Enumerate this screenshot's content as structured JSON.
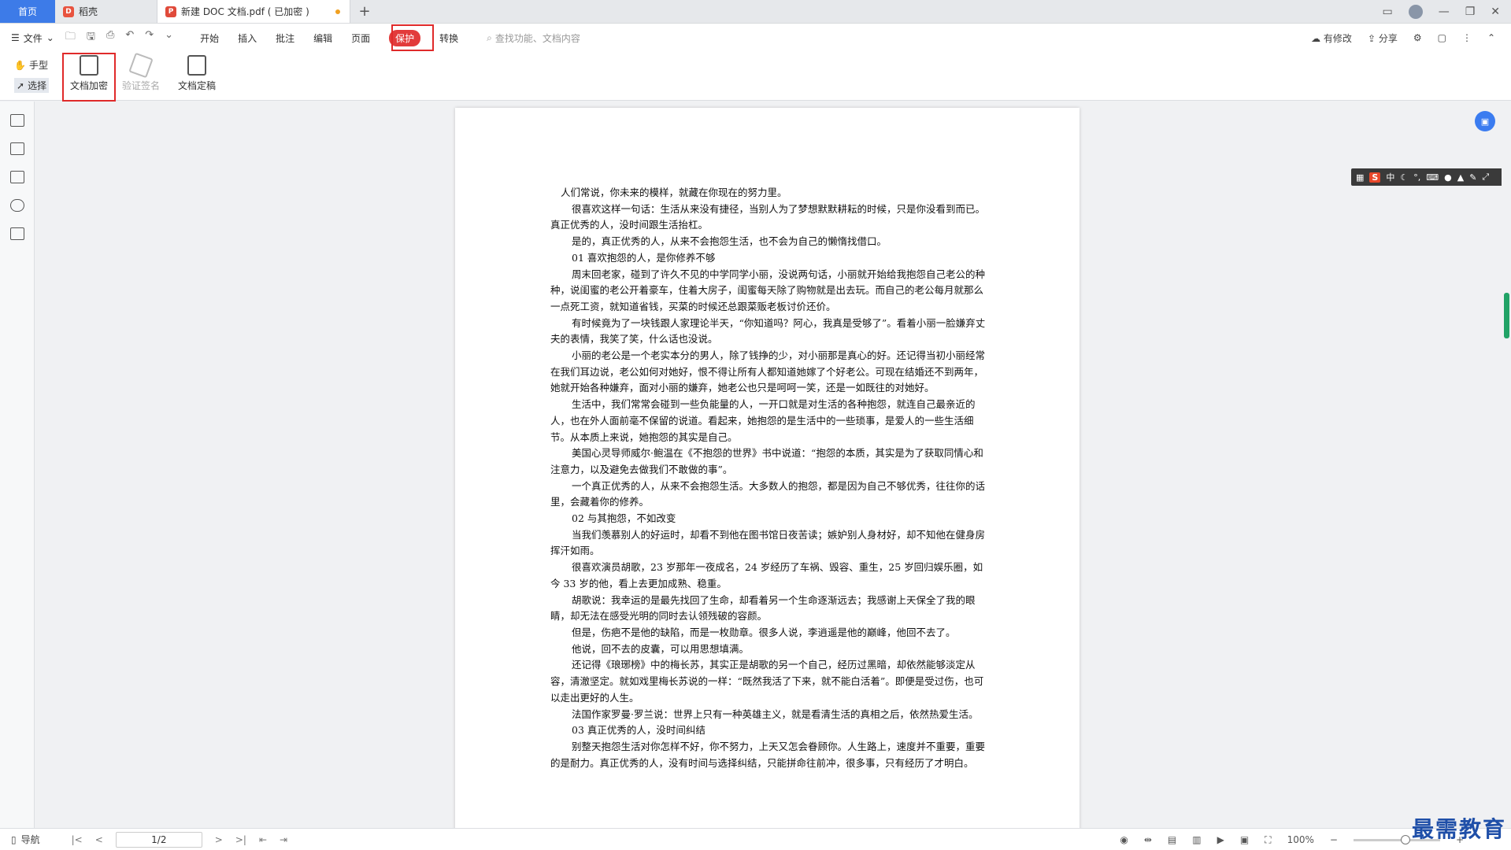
{
  "tabs": {
    "home": "首页",
    "daoke": "稻壳",
    "doc": "新建 DOC 文档.pdf ( 已加密 )",
    "add": "+"
  },
  "menu": {
    "file": "文件",
    "items": [
      "开始",
      "插入",
      "批注",
      "编辑",
      "页面",
      "保护",
      "转换"
    ],
    "search_placeholder": "查找功能、文档内容",
    "modified": "有修改",
    "share": "分享"
  },
  "ribbon": {
    "hand": "手型",
    "select": "选择",
    "encrypt": "文档加密",
    "verify_sign": "验证签名",
    "finalize": "文档定稿"
  },
  "document": {
    "paragraphs": [
      {
        "style": "first",
        "text": "人们常说，你未来的模样，就藏在你现在的努力里。"
      },
      {
        "style": "ind",
        "text": "很喜欢这样一句话：生活从来没有捷径，当别人为了梦想默默耕耘的时候，只是你没看到而已。真正优秀的人，没时间跟生活抬杠。"
      },
      {
        "style": "ind",
        "text": "是的，真正优秀的人，从来不会抱怨生活，也不会为自己的懒惰找借口。"
      },
      {
        "style": "ind",
        "text": "01 喜欢抱怨的人，是你修养不够"
      },
      {
        "style": "ind",
        "text": "周末回老家，碰到了许久不见的中学同学小丽，没说两句话，小丽就开始给我抱怨自己老公的种种，说闺蜜的老公开着豪车，住着大房子，闺蜜每天除了购物就是出去玩。而自己的老公每月就那么一点死工资，就知道省钱，买菜的时候还总跟菜贩老板讨价还价。"
      },
      {
        "style": "ind",
        "text": "有时候竟为了一块钱跟人家理论半天，“你知道吗？阿心，我真是受够了”。看着小丽一脸嫌弃丈夫的表情，我笑了笑，什么话也没说。"
      },
      {
        "style": "ind",
        "text": "小丽的老公是一个老实本分的男人，除了钱挣的少，对小丽那是真心的好。还记得当初小丽经常在我们耳边说，老公如何对她好，恨不得让所有人都知道她嫁了个好老公。可现在结婚还不到两年，她就开始各种嫌弃，面对小丽的嫌弃，她老公也只是呵呵一笑，还是一如既往的对她好。"
      },
      {
        "style": "ind",
        "text": "生活中，我们常常会碰到一些负能量的人，一开口就是对生活的各种抱怨，就连自己最亲近的人，也在外人面前毫不保留的说道。看起来，她抱怨的是生活中的一些琐事，是爱人的一些生活细节。从本质上来说，她抱怨的其实是自己。"
      },
      {
        "style": "ind",
        "text": "美国心灵导师威尔·鲍温在《不抱怨的世界》书中说道：“抱怨的本质，其实是为了获取同情心和注意力，以及避免去做我们不敢做的事”。"
      },
      {
        "style": "ind",
        "text": "一个真正优秀的人，从来不会抱怨生活。大多数人的抱怨，都是因为自己不够优秀，往往你的话里，会藏着你的修养。"
      },
      {
        "style": "ind",
        "text": "02 与其抱怨，不如改变"
      },
      {
        "style": "ind",
        "text": "当我们羡慕别人的好运时，却看不到他在图书馆日夜苦读；嫉妒别人身材好，却不知他在健身房挥汗如雨。"
      },
      {
        "style": "ind",
        "text": "很喜欢演员胡歌，23 岁那年一夜成名，24 岁经历了车祸、毁容、重生，25 岁回归娱乐圈，如今 33 岁的他，看上去更加成熟、稳重。"
      },
      {
        "style": "ind",
        "text": "胡歌说：我幸运的是最先找回了生命，却看着另一个生命逐渐远去；我感谢上天保全了我的眼睛，却无法在感受光明的同时去认领残破的容颜。"
      },
      {
        "style": "ind",
        "text": "但是，伤疤不是他的缺陷，而是一枚勋章。很多人说，李逍遥是他的巅峰，他回不去了。"
      },
      {
        "style": "ind",
        "text": "他说，回不去的皮囊，可以用思想填满。"
      },
      {
        "style": "ind",
        "text": "还记得《琅琊榜》中的梅长苏，其实正是胡歌的另一个自己，经历过黑暗，却依然能够淡定从容，清澈坚定。就如戏里梅长苏说的一样：“既然我活了下来，就不能白活着”。即便是受过伤，也可以走出更好的人生。"
      },
      {
        "style": "ind",
        "text": "法国作家罗曼·罗兰说：世界上只有一种英雄主义，就是看清生活的真相之后，依然热爱生活。"
      },
      {
        "style": "ind",
        "text": "03 真正优秀的人，没时间纠结"
      },
      {
        "style": "ind",
        "text": "别整天抱怨生活对你怎样不好，你不努力，上天又怎会眷顾你。人生路上，速度并不重要，重要的是耐力。真正优秀的人，没有时间与选择纠结，只能拼命往前冲，很多事，只有经历了才明白。"
      }
    ]
  },
  "ime": {
    "s": "S",
    "lang": "中"
  },
  "status": {
    "nav": "导航",
    "page": "1/2",
    "zoom": "100%",
    "zoom_level_fraction": 0.6
  },
  "watermark": "最需教育",
  "colors": {
    "accent": "#3d7be8",
    "protect": "#e23b3b",
    "highlight_box": "#e02a2a",
    "scroll_thumb": "#21a366"
  }
}
